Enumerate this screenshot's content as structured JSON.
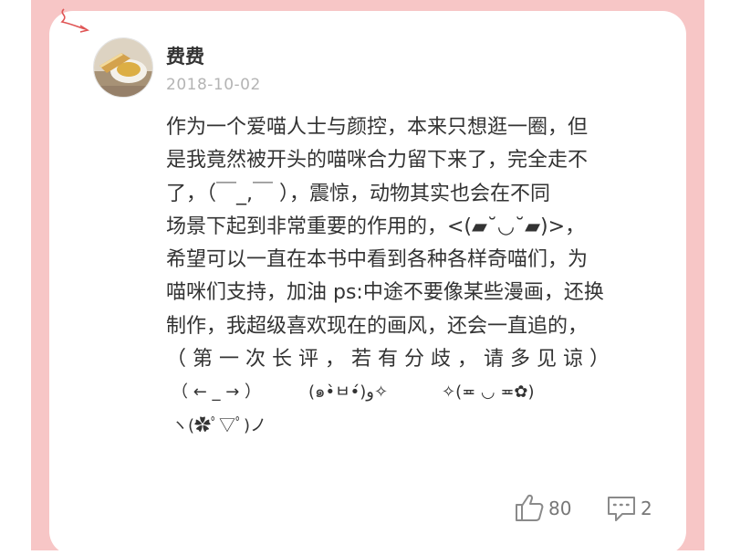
{
  "post": {
    "username": "费费",
    "date": "2018-10-02",
    "lines": [
      "作为一个爱喵人士与颜控，本来只想逛一圈，但",
      "是我竟然被开头的喵咪合力留下来了，完全走不",
      "了，（￣_,￣ ），震惊，动物其实也会在不同",
      "场景下起到非常重要的作用的，<(▰˘◡˘▰)>，",
      "希望可以一直在本书中看到各种各样奇喵们，为",
      "喵咪们支持，加油 ps:中途不要像某些漫画，还换",
      "制作，我超级喜欢现在的画风，还会一直追的，",
      "（第一次长评，若有分歧，请多见谅）"
    ],
    "kaomoji": [
      "（ ← _ → ）",
      "(๑•̀ㅂ•́)و✧",
      "✧(≖ ◡ ≖✿)",
      "ヽ(✿ﾟ▽ﾟ)ノ"
    ]
  },
  "actions": {
    "like_count": "80",
    "comment_count": "2"
  },
  "colors": {
    "frame_pink": "#f7c6c6",
    "arrow_red": "#e05555"
  }
}
